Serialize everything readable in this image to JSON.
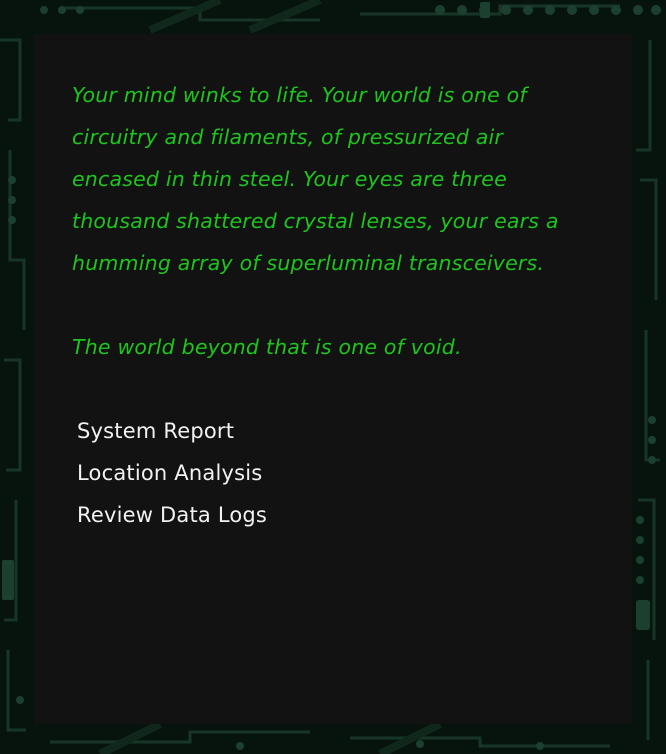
{
  "story": {
    "paragraphs": [
      "Your mind winks to life. Your world is one of circuitry and filaments, of pressurized air encased in thin steel. Your eyes are three thousand shattered crystal lenses, your ears a humming array of superluminal transceivers.",
      "The world beyond that is one of void."
    ]
  },
  "menu": {
    "items": [
      "System Report",
      "Location Analysis",
      "Review Data Logs"
    ]
  },
  "colors": {
    "background": "#07130d",
    "panel": "#121212",
    "narrative_text": "#1ec51e",
    "menu_text": "#f2f2f2",
    "circuit_trace": "#173626"
  }
}
